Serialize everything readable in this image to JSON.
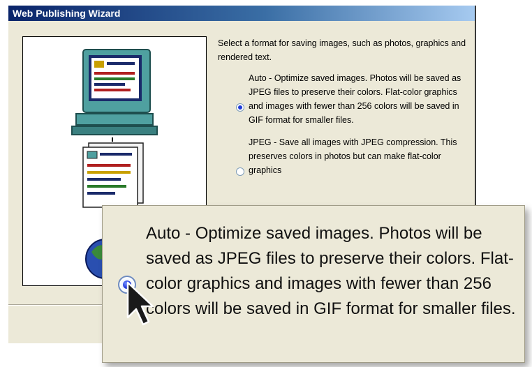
{
  "window": {
    "title": "Web Publishing Wizard"
  },
  "dialog": {
    "prompt": "Select a format for saving images, such as photos, graphics and rendered text.",
    "options": [
      {
        "label": "Auto - Optimize saved images. Photos will be saved as JPEG files to preserve their colors. Flat-color graphics and images with fewer than 256 colors will be saved in GIF format for smaller files.",
        "selected": true
      },
      {
        "label": "JPEG - Save all images with JPEG compression. This preserves colors in photos but can make flat-color graphics",
        "selected": false
      }
    ]
  },
  "callout": {
    "text": "Auto - Optimize saved images. Photos will be saved as JPEG files to preserve their colors. Flat-color graphics and images with fewer than 256 colors will be saved in GIF format for smaller files."
  },
  "colors": {
    "titlebar": "#0a246a",
    "dialog_bg": "#ece9d8",
    "monitor": "#4fa0a0",
    "radio_selected": "#1f3bd8"
  },
  "icons": [
    "monitor-icon",
    "document-icon",
    "globe-icon",
    "pointer-cursor-icon",
    "radio-selected-icon"
  ]
}
